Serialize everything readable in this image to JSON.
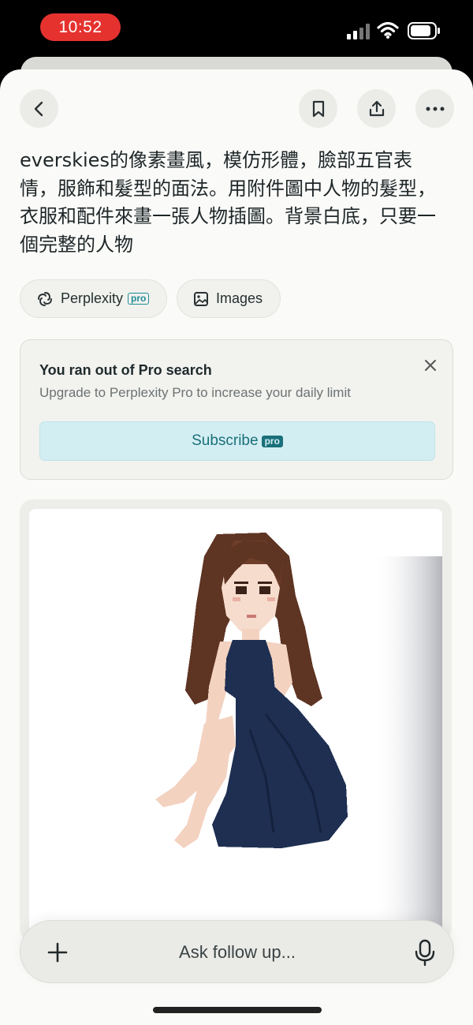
{
  "status_bar": {
    "time": "10:52",
    "icons": [
      "cellular-signal-icon",
      "wifi-icon",
      "battery-icon"
    ]
  },
  "header": {
    "icons": [
      "chevron-left-icon",
      "bookmark-icon",
      "share-icon",
      "more-horizontal-icon"
    ]
  },
  "question": {
    "text": "everskies的像素畫風，模仿形體，臉部五官表情，服飾和髮型的面法。用附件圖中人物的髮型，衣服和配件來畫一張人物插圖。背景白底，只要一個完整的人物"
  },
  "chips": [
    {
      "label": "Perplexity",
      "badge": "pro",
      "icon": "perplexity-logo-icon"
    },
    {
      "label": "Images",
      "icon": "image-icon"
    }
  ],
  "banner": {
    "title": "You ran out of Pro search",
    "subtitle": "Upgrade to Perplexity Pro to increase your daily limit",
    "button_label": "Subscribe",
    "button_badge": "pro"
  },
  "followup": {
    "placeholder": "Ask follow up..."
  },
  "colors": {
    "time_pill": "#e5322f",
    "accent": "#19707a",
    "subscribe_bg": "#d3eef3",
    "sheet_bg": "#fafaf8",
    "dress": "#1e2f52",
    "hair": "#5e3423"
  }
}
